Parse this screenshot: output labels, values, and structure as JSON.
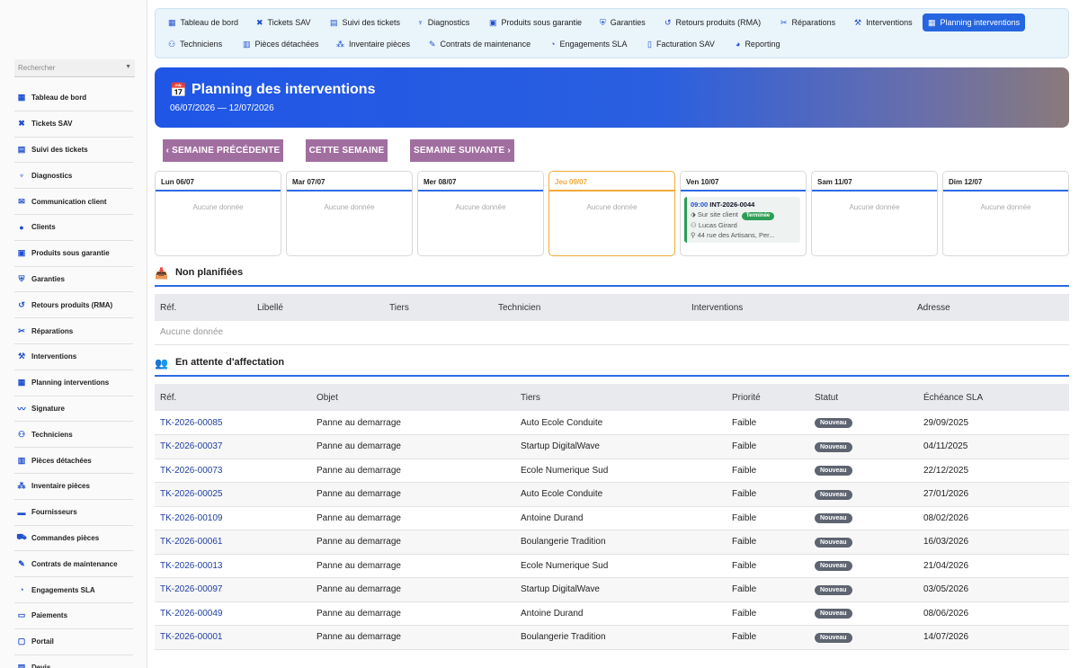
{
  "search": {
    "placeholder": "Rechercher"
  },
  "sidebar": {
    "items": [
      {
        "label": "Tableau de bord",
        "icon": "grid-icon"
      },
      {
        "label": "Tickets SAV",
        "icon": "ticket-icon"
      },
      {
        "label": "Suivi des tickets",
        "icon": "table-icon"
      },
      {
        "label": "Diagnostics",
        "icon": "stethoscope-icon"
      },
      {
        "label": "Communication client",
        "icon": "chat-icon"
      },
      {
        "label": "Clients",
        "icon": "user-icon"
      },
      {
        "label": "Produits sous garantie",
        "icon": "box-icon"
      },
      {
        "label": "Garanties",
        "icon": "shield-icon"
      },
      {
        "label": "Retours produits (RMA)",
        "icon": "undo-icon"
      },
      {
        "label": "Réparations",
        "icon": "tools-icon"
      },
      {
        "label": "Interventions",
        "icon": "wrench-icon"
      },
      {
        "label": "Planning interventions",
        "icon": "calendar-icon"
      },
      {
        "label": "Signature",
        "icon": "signature-icon"
      },
      {
        "label": "Techniciens",
        "icon": "users-icon"
      },
      {
        "label": "Pièces détachées",
        "icon": "parts-icon"
      },
      {
        "label": "Inventaire pièces",
        "icon": "inventory-icon"
      },
      {
        "label": "Fournisseurs",
        "icon": "truck-icon"
      },
      {
        "label": "Commandes pièces",
        "icon": "cart-icon"
      },
      {
        "label": "Contrats de maintenance",
        "icon": "contract-icon"
      },
      {
        "label": "Engagements SLA",
        "icon": "clock-icon"
      },
      {
        "label": "Paiements",
        "icon": "payment-icon"
      },
      {
        "label": "Portail",
        "icon": "portal-icon"
      },
      {
        "label": "Devis",
        "icon": "quote-icon"
      }
    ]
  },
  "tabs": [
    {
      "label": "Tableau de bord",
      "icon": "grid-icon"
    },
    {
      "label": "Tickets SAV",
      "icon": "ticket-icon"
    },
    {
      "label": "Suivi des tickets",
      "icon": "table-icon"
    },
    {
      "label": "Diagnostics",
      "icon": "stethoscope-icon"
    },
    {
      "label": "Produits sous garantie",
      "icon": "box-icon"
    },
    {
      "label": "Garanties",
      "icon": "shield-icon"
    },
    {
      "label": "Retours produits (RMA)",
      "icon": "undo-icon"
    },
    {
      "label": "Réparations",
      "icon": "tools-icon"
    },
    {
      "label": "Interventions",
      "icon": "wrench-icon"
    },
    {
      "label": "Planning interventions",
      "icon": "calendar-icon",
      "active": true
    },
    {
      "label": "Techniciens",
      "icon": "users-icon"
    },
    {
      "label": "Pièces détachées",
      "icon": "parts-icon"
    },
    {
      "label": "Inventaire pièces",
      "icon": "inventory-icon"
    },
    {
      "label": "Contrats de maintenance",
      "icon": "contract-icon"
    },
    {
      "label": "Engagements SLA",
      "icon": "clock-icon"
    },
    {
      "label": "Facturation SAV",
      "icon": "invoice-icon"
    },
    {
      "label": "Reporting",
      "icon": "chart-icon"
    }
  ],
  "header": {
    "title": "Planning des interventions",
    "range": "06/07/2026 — 12/07/2026"
  },
  "week_nav": {
    "prev": "SEMAINE PRÉCÉDENTE",
    "current": "CETTE SEMAINE",
    "next": "SEMAINE SUIVANTE"
  },
  "empty_text": "Aucune donnée",
  "days": [
    {
      "label": "Lun 06/07"
    },
    {
      "label": "Mar 07/07"
    },
    {
      "label": "Mer 08/07"
    },
    {
      "label": "Jeu 09/07",
      "today": true
    },
    {
      "label": "Ven 10/07",
      "event": {
        "time": "09:00",
        "ref": "INT-2026-0044",
        "type": "Sur site client",
        "status": "Terminée",
        "tech": "Lucas Girard",
        "address": "44 rue des Artisans, Per..."
      }
    },
    {
      "label": "Sam 11/07"
    },
    {
      "label": "Dim 12/07"
    }
  ],
  "unplanned": {
    "title": "Non planifiées",
    "columns": [
      "Réf.",
      "Libellé",
      "Tiers",
      "Technicien",
      "Interventions",
      "Adresse"
    ]
  },
  "pending": {
    "title": "En attente d'affectation",
    "columns": [
      "Réf.",
      "Objet",
      "Tiers",
      "Priorité",
      "Statut",
      "Échéance SLA"
    ],
    "rows": [
      [
        "TK-2026-00085",
        "Panne au demarrage",
        "Auto Ecole Conduite",
        "Faible",
        "Nouveau",
        "29/09/2025"
      ],
      [
        "TK-2026-00037",
        "Panne au demarrage",
        "Startup DigitalWave",
        "Faible",
        "Nouveau",
        "04/11/2025"
      ],
      [
        "TK-2026-00073",
        "Panne au demarrage",
        "Ecole Numerique Sud",
        "Faible",
        "Nouveau",
        "22/12/2025"
      ],
      [
        "TK-2026-00025",
        "Panne au demarrage",
        "Auto Ecole Conduite",
        "Faible",
        "Nouveau",
        "27/01/2026"
      ],
      [
        "TK-2026-00109",
        "Panne au demarrage",
        "Antoine Durand",
        "Faible",
        "Nouveau",
        "08/02/2026"
      ],
      [
        "TK-2026-00061",
        "Panne au demarrage",
        "Boulangerie Tradition",
        "Faible",
        "Nouveau",
        "16/03/2026"
      ],
      [
        "TK-2026-00013",
        "Panne au demarrage",
        "Ecole Numerique Sud",
        "Faible",
        "Nouveau",
        "21/04/2026"
      ],
      [
        "TK-2026-00097",
        "Panne au demarrage",
        "Startup DigitalWave",
        "Faible",
        "Nouveau",
        "03/05/2026"
      ],
      [
        "TK-2026-00049",
        "Panne au demarrage",
        "Antoine Durand",
        "Faible",
        "Nouveau",
        "08/06/2026"
      ],
      [
        "TK-2026-00001",
        "Panne au demarrage",
        "Boulangerie Tradition",
        "Faible",
        "Nouveau",
        "14/07/2026"
      ]
    ]
  }
}
